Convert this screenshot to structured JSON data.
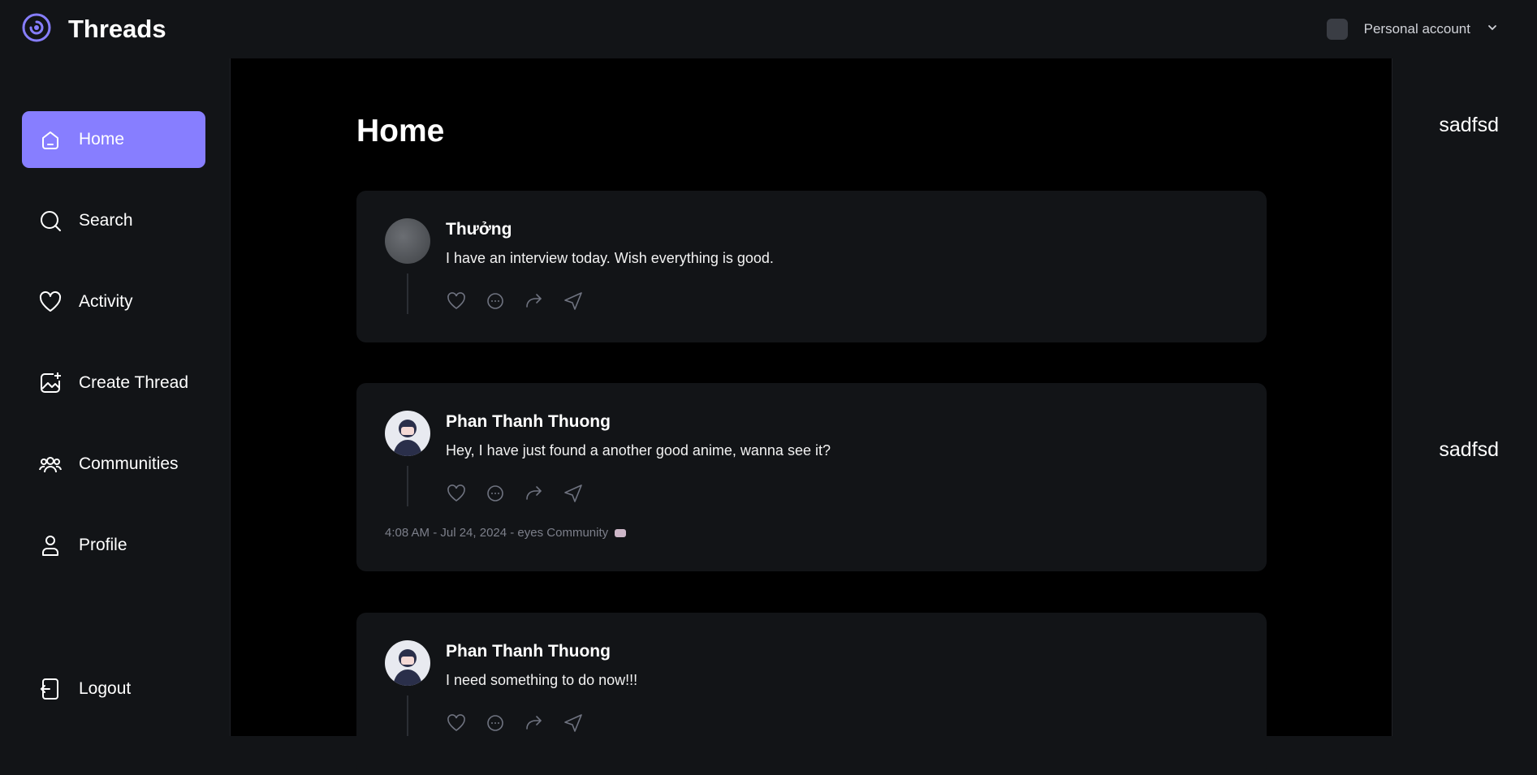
{
  "app": {
    "title": "Threads",
    "brand_color": "#877eff"
  },
  "account": {
    "label": "Personal account"
  },
  "sidebar": {
    "items": [
      {
        "label": "Home",
        "icon": "home-icon",
        "active": true
      },
      {
        "label": "Search",
        "icon": "search-icon"
      },
      {
        "label": "Activity",
        "icon": "heart-icon"
      },
      {
        "label": "Create Thread",
        "icon": "create-icon"
      },
      {
        "label": "Communities",
        "icon": "communities-icon"
      },
      {
        "label": "Profile",
        "icon": "profile-icon"
      }
    ],
    "logout": "Logout"
  },
  "main": {
    "title": "Home",
    "threads": [
      {
        "author": "Thưởng",
        "text": "I have an interview today. Wish everything is good."
      },
      {
        "author": "Phan Thanh Thuong",
        "text": "Hey, I have just found a another good anime, wanna see it?",
        "meta": "4:08 AM - Jul 24, 2024 - eyes Community"
      },
      {
        "author": "Phan Thanh Thuong",
        "text": "I need something to do now!!!"
      }
    ]
  },
  "right": {
    "items": [
      "sadfsd",
      "sadfsd"
    ]
  }
}
